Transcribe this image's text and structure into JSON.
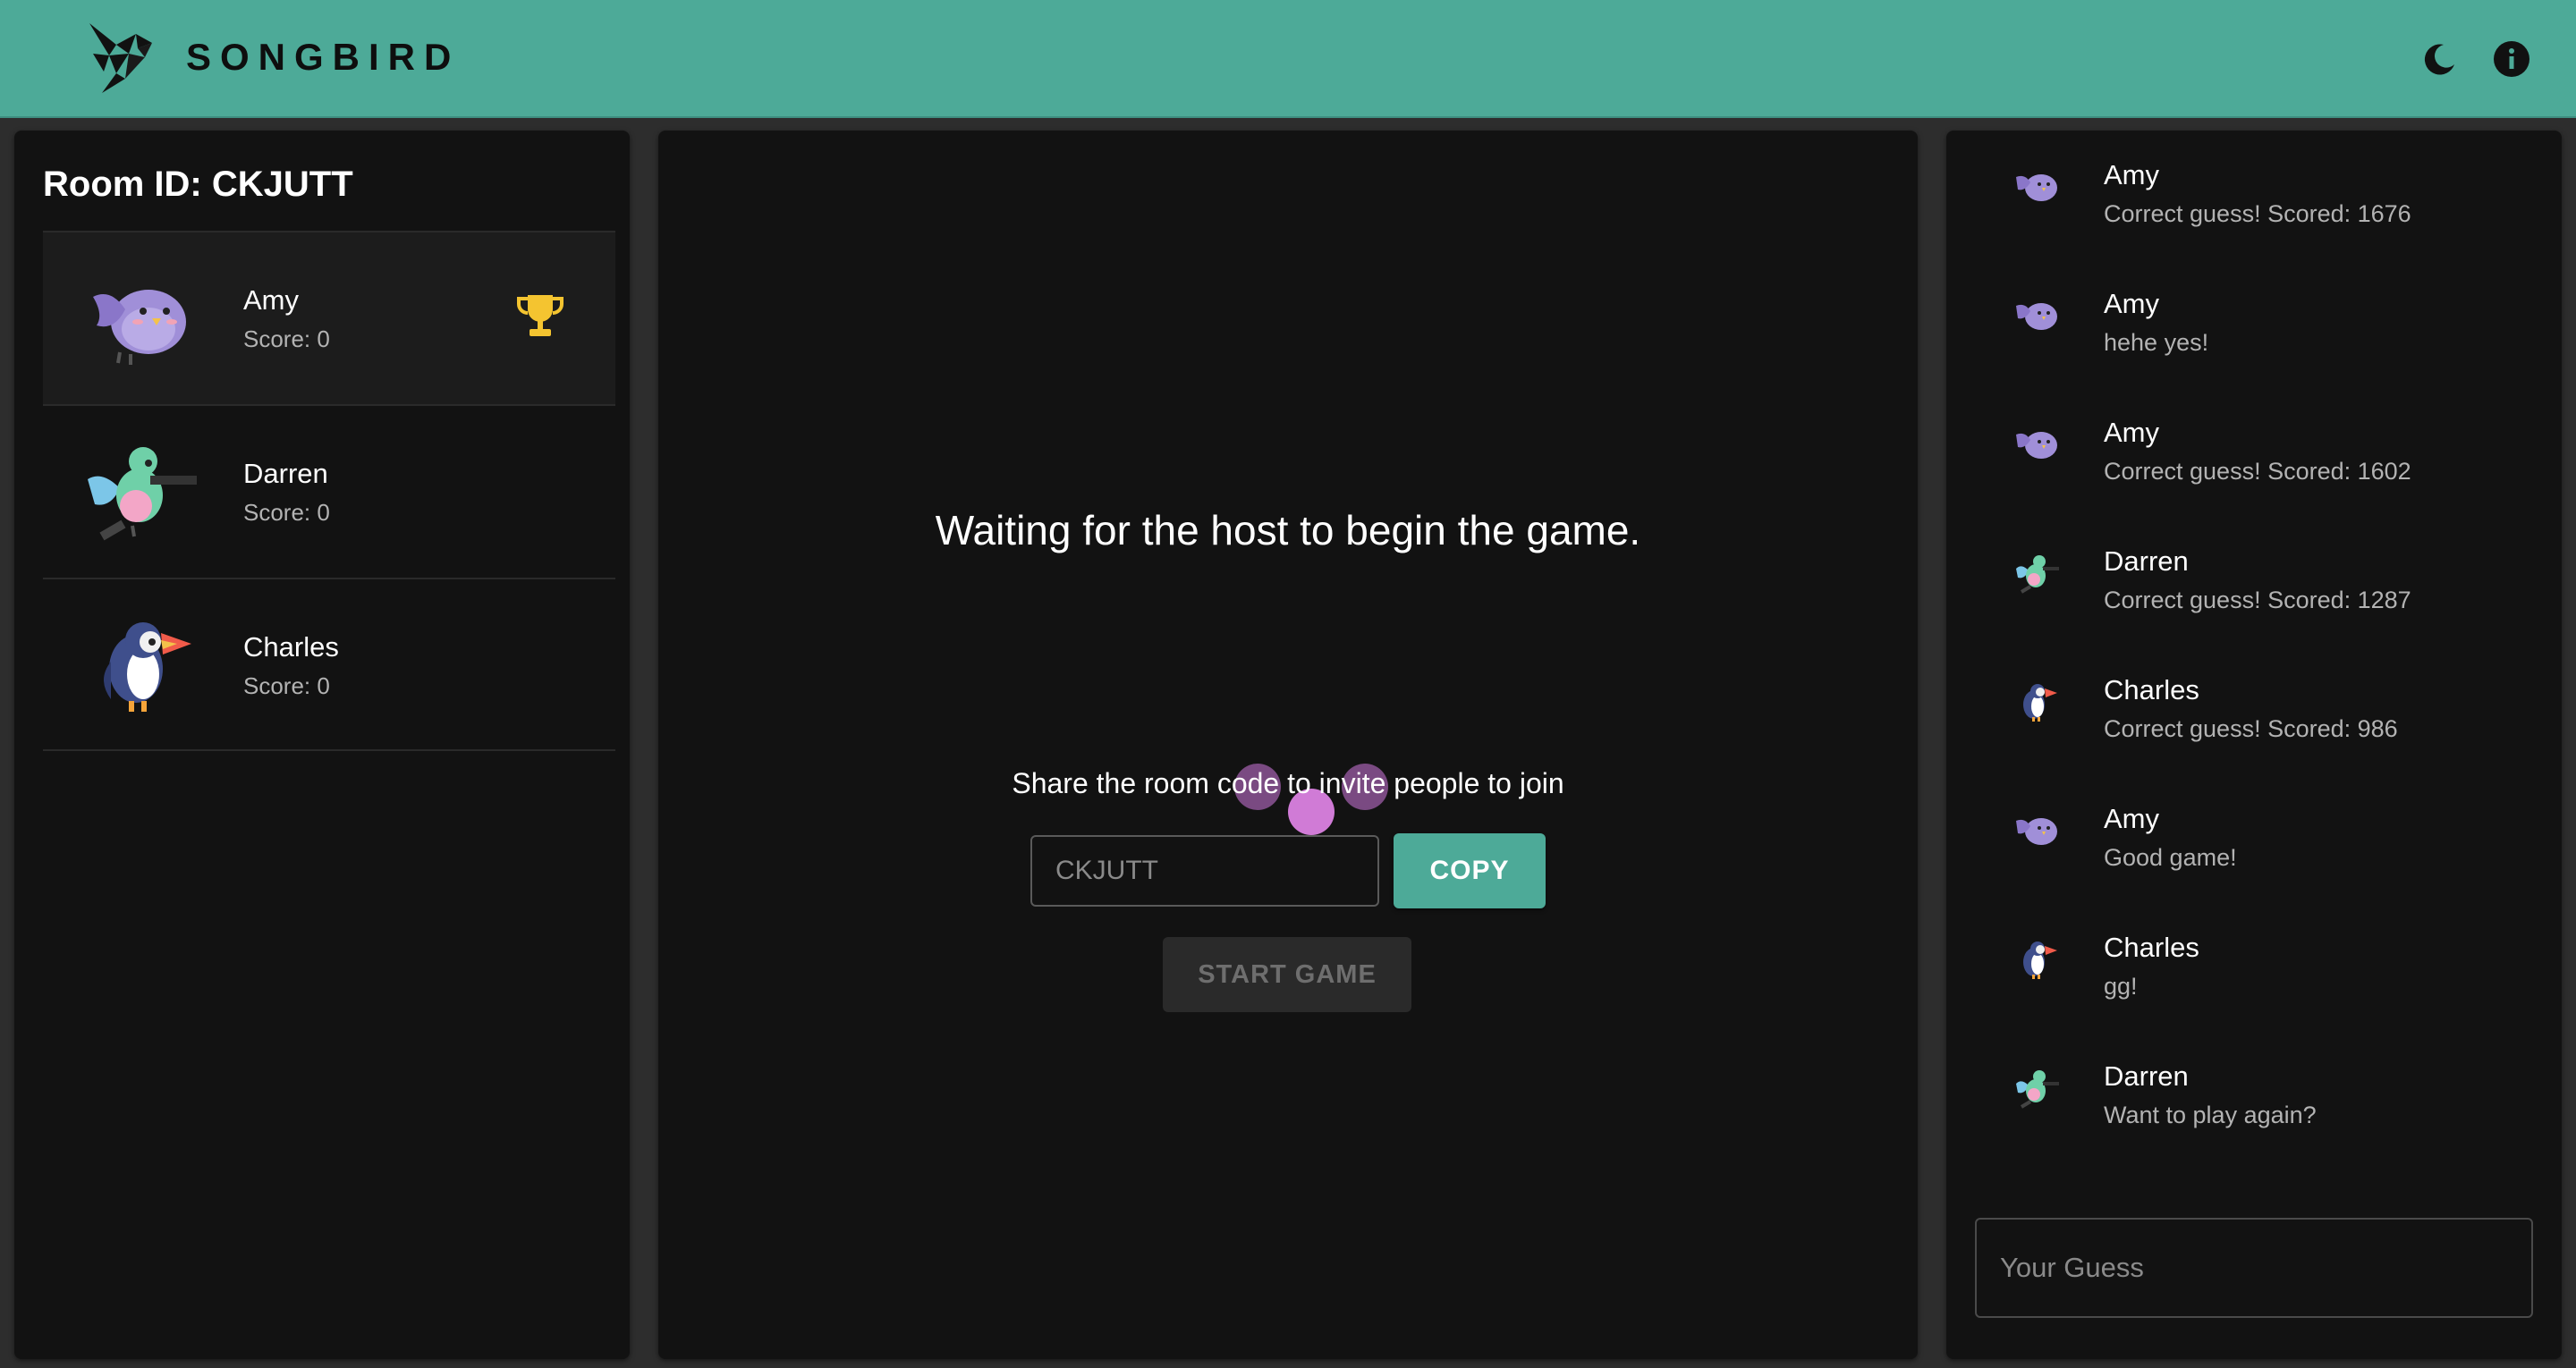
{
  "app": {
    "brand": "SONGBIRD",
    "accent_color": "#4daa98"
  },
  "header": {
    "theme_toggle_icon": "moon-icon",
    "info_icon": "info-icon"
  },
  "room": {
    "title": "Room ID: CKJUTT"
  },
  "players": [
    {
      "name": "Amy",
      "score": "Score: 0",
      "avatar": "purple-bird-avatar",
      "leader": true
    },
    {
      "name": "Darren",
      "score": "Score: 0",
      "avatar": "hummingbird-avatar",
      "leader": false
    },
    {
      "name": "Charles",
      "score": "Score: 0",
      "avatar": "puffin-avatar",
      "leader": false
    }
  ],
  "lobby": {
    "waiting_text": "Waiting for the host to begin the game.",
    "share_text": "Share the room code to invite people to join",
    "room_code_value": "CKJUTT",
    "copy_label": "COPY",
    "start_label": "START GAME"
  },
  "chat": {
    "messages": [
      {
        "name": "Amy",
        "text": "Correct guess! Scored: 1676",
        "avatar": "purple-bird-avatar"
      },
      {
        "name": "Amy",
        "text": "hehe yes!",
        "avatar": "purple-bird-avatar"
      },
      {
        "name": "Amy",
        "text": "Correct guess! Scored: 1602",
        "avatar": "purple-bird-avatar"
      },
      {
        "name": "Darren",
        "text": "Correct guess! Scored: 1287",
        "avatar": "hummingbird-avatar"
      },
      {
        "name": "Charles",
        "text": "Correct guess! Scored: 986",
        "avatar": "puffin-avatar"
      },
      {
        "name": "Amy",
        "text": "Good game!",
        "avatar": "purple-bird-avatar"
      },
      {
        "name": "Charles",
        "text": "gg!",
        "avatar": "puffin-avatar"
      },
      {
        "name": "Darren",
        "text": "Want to play again?",
        "avatar": "hummingbird-avatar"
      }
    ],
    "guess_placeholder": "Your Guess"
  }
}
